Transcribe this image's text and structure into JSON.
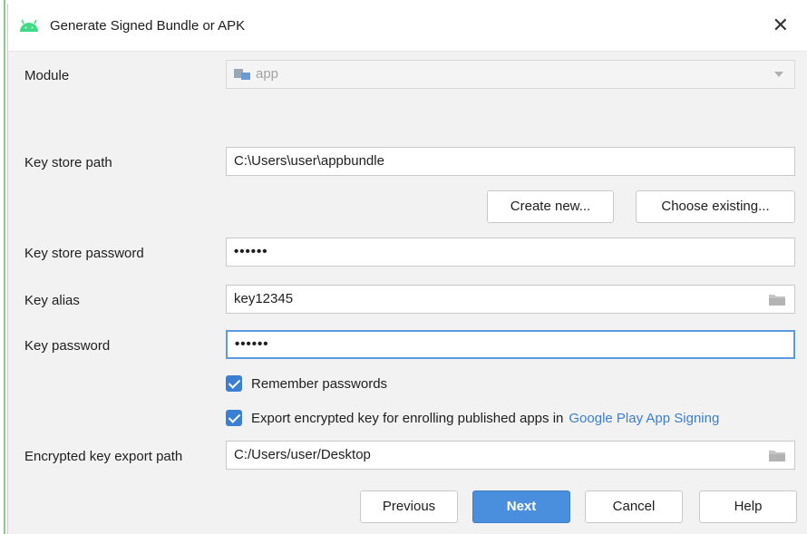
{
  "dialog": {
    "title": "Generate Signed Bundle or APK",
    "close_glyph": "✕"
  },
  "module": {
    "label": "Module",
    "value": "app"
  },
  "keystore": {
    "path_label": "Key store path",
    "path_value": "C:\\Users\\user\\appbundle",
    "create_new": "Create new...",
    "choose_existing": "Choose existing...",
    "password_label": "Key store password",
    "password_value": "••••••"
  },
  "key": {
    "alias_label": "Key alias",
    "alias_value": "key12345",
    "password_label": "Key password",
    "password_value": "••••••"
  },
  "options": {
    "remember_passwords": "Remember passwords",
    "remember_checked": true,
    "export_encrypted": "Export encrypted key for enrolling published apps in",
    "export_checked": true,
    "google_play_link": "Google Play App Signing"
  },
  "export_path": {
    "label": "Encrypted key export path",
    "value": "C:/Users/user/Desktop"
  },
  "buttons": {
    "previous": "Previous",
    "next": "Next",
    "cancel": "Cancel",
    "help": "Help"
  },
  "colors": {
    "accent": "#4a8fde",
    "link": "#3b7ed4",
    "android_green": "#3ddc84"
  },
  "icons": [
    "android-icon",
    "close-icon",
    "module-icon",
    "chevron-down-icon",
    "folder-icon",
    "checkbox-checked-icon"
  ]
}
